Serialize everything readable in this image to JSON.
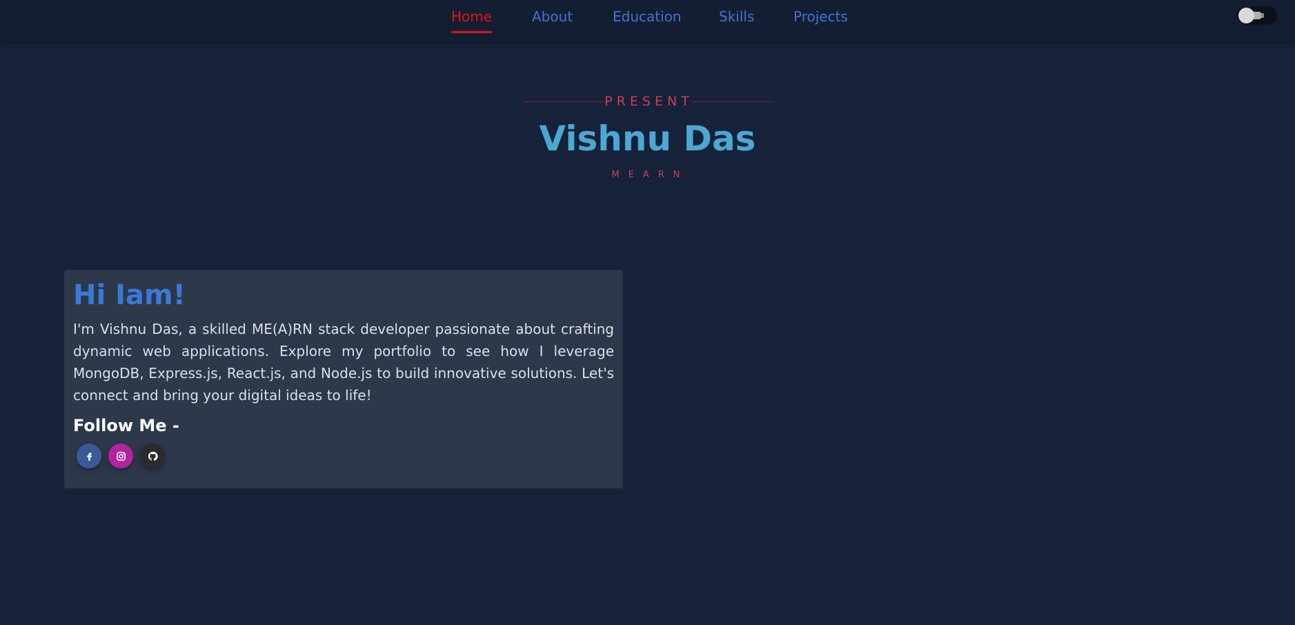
{
  "nav": {
    "items": [
      {
        "label": "Home",
        "active": true
      },
      {
        "label": "About",
        "active": false
      },
      {
        "label": "Education",
        "active": false
      },
      {
        "label": "Skills",
        "active": false
      },
      {
        "label": "Projects",
        "active": false
      }
    ],
    "theme_toggle": {
      "icon": "lightbulb-toggle-icon",
      "state": "off"
    }
  },
  "hero": {
    "subtitle": "PRESENT",
    "name": "Vishnu Das",
    "stack": "MEARN"
  },
  "intro": {
    "heading": "Hi Iam!",
    "text": "I'm Vishnu Das, a skilled ME(A)RN stack developer passionate about crafting dynamic web applications. Explore my portfolio to see how I leverage MongoDB, Express.js, React.js, and Node.js to build innovative solutions. Let's connect and bring your digital ideas to life!",
    "follow_heading": "Follow Me -",
    "socials": [
      {
        "icon": "facebook-icon",
        "color": "#3b5998"
      },
      {
        "icon": "instagram-icon",
        "color": "#b0249f"
      },
      {
        "icon": "github-icon",
        "color": "#2b2b2b"
      }
    ]
  },
  "colors": {
    "background": "#16213a",
    "nav_link": "#3f74d4",
    "nav_active": "#e01414",
    "accent_red": "#d23b55",
    "name_blue": "#4aa8d2",
    "card_bg": "#2d384b"
  }
}
